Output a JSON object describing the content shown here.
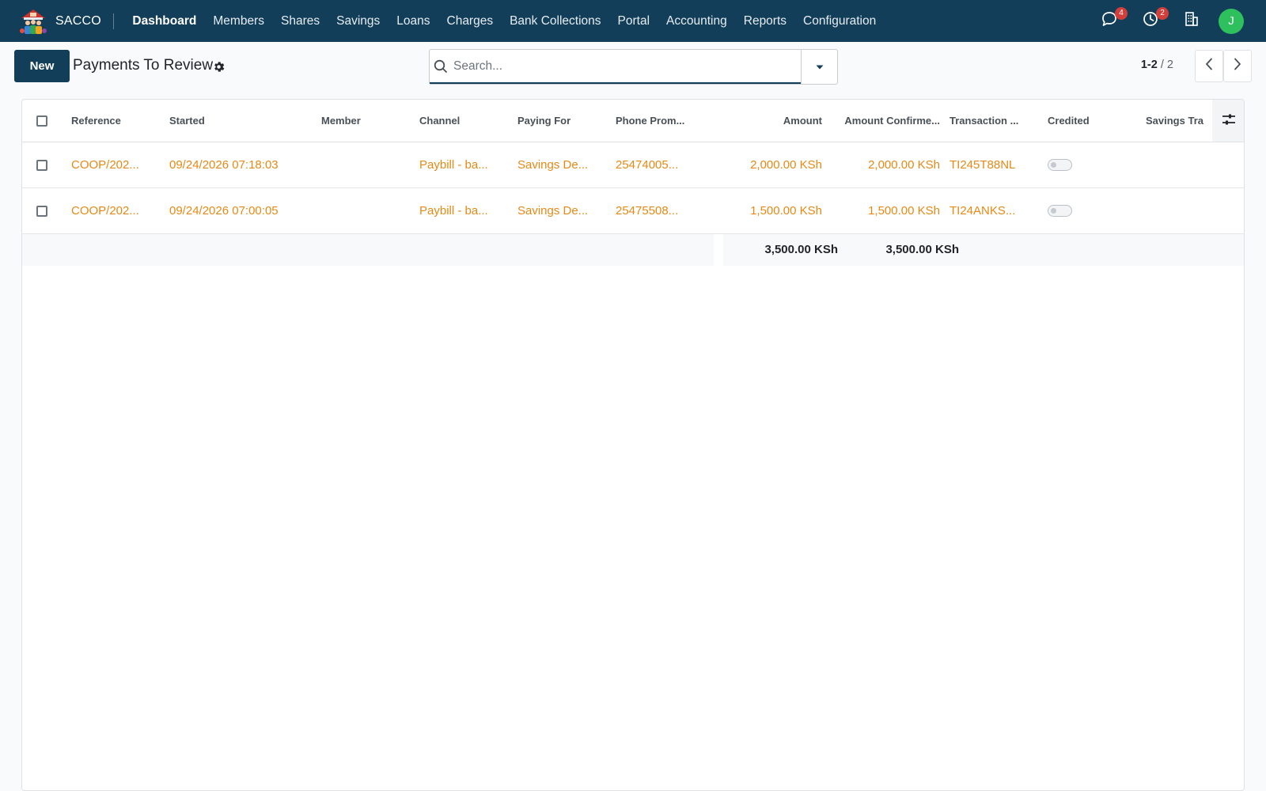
{
  "app": {
    "brand": "SACCO",
    "menu": [
      "Dashboard",
      "Members",
      "Shares",
      "Savings",
      "Loans",
      "Charges",
      "Bank Collections",
      "Portal",
      "Accounting",
      "Reports",
      "Configuration"
    ],
    "messages_badge": "4",
    "activities_badge": "2",
    "avatar_initial": "J"
  },
  "control": {
    "new_label": "New",
    "title": "Payments To Review",
    "search_placeholder": "Search...",
    "pager_range": "1-2",
    "pager_sep": " / ",
    "pager_total": "2"
  },
  "table": {
    "headers": {
      "reference": "Reference",
      "started": "Started",
      "member": "Member",
      "channel": "Channel",
      "paying_for": "Paying For",
      "phone": "Phone Prom...",
      "amount": "Amount",
      "amount_confirmed": "Amount Confirme...",
      "transaction": "Transaction ...",
      "credited": "Credited",
      "savings": "Savings Tra"
    },
    "rows": [
      {
        "reference": "COOP/202...",
        "started": "09/24/2026 07:18:03",
        "member": "",
        "channel": "Paybill - ba...",
        "paying_for": "Savings De...",
        "phone": "25474005...",
        "amount": "2,000.00 KSh",
        "amount_confirmed": "2,000.00 KSh",
        "transaction": "TI245T88NL",
        "credited": false,
        "savings": ""
      },
      {
        "reference": "COOP/202...",
        "started": "09/24/2026 07:00:05",
        "member": "",
        "channel": "Paybill - ba...",
        "paying_for": "Savings De...",
        "phone": "25475508...",
        "amount": "1,500.00 KSh",
        "amount_confirmed": "1,500.00 KSh",
        "transaction": "TI24ANKS...",
        "credited": false,
        "savings": ""
      }
    ],
    "totals": {
      "amount": "3,500.00 KSh",
      "amount_confirmed": "3,500.00 KSh"
    }
  },
  "colors": {
    "navbar": "#123e5a",
    "link": "#e58a17",
    "badge": "#d23f3a",
    "avatar": "#2ec05d"
  },
  "icons": [
    "app-logo-icon",
    "gear-icon",
    "search-icon",
    "caret-down-icon",
    "chevron-left-icon",
    "chevron-right-icon",
    "chat-icon",
    "clock-icon",
    "building-icon",
    "column-settings-icon"
  ]
}
